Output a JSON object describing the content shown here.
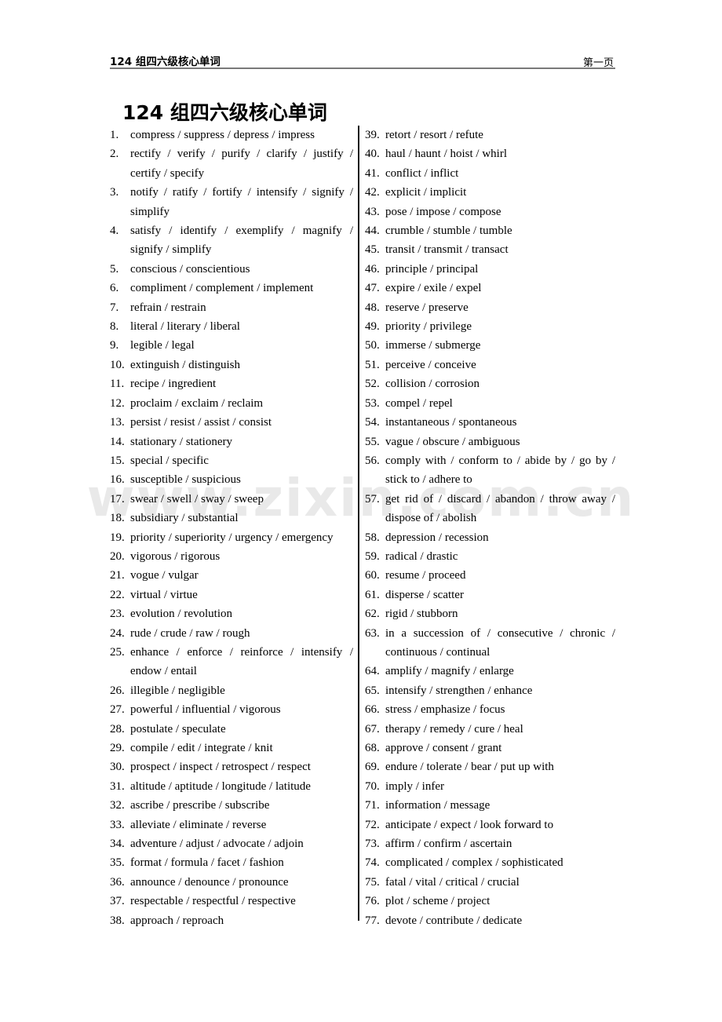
{
  "header": {
    "left_title": "124 组四六级核心单词",
    "page_label": "第一页"
  },
  "document": {
    "title": "124 组四六级核心单词",
    "watermark": "www.zixin.com.cn"
  },
  "columns": {
    "left": [
      {
        "num": "1.",
        "text": "compress / suppress / depress / impress",
        "wrap": false
      },
      {
        "num": "2.",
        "text": "rectify / verify / purify / clarify / justify / certify / specify",
        "wrap": true
      },
      {
        "num": "3.",
        "text": "notify / ratify / fortify / intensify / signify / simplify",
        "wrap": true
      },
      {
        "num": "4.",
        "text": "satisfy / identify / exemplify / magnify / signify / simplify",
        "wrap": true
      },
      {
        "num": "5.",
        "text": "conscious / conscientious",
        "wrap": false
      },
      {
        "num": "6.",
        "text": "compliment / complement / implement",
        "wrap": false
      },
      {
        "num": "7.",
        "text": "refrain / restrain",
        "wrap": false
      },
      {
        "num": "8.",
        "text": "literal / literary / liberal",
        "wrap": false
      },
      {
        "num": "9.",
        "text": "legible / legal",
        "wrap": false
      },
      {
        "num": "10.",
        "text": "extinguish / distinguish",
        "wrap": false
      },
      {
        "num": "11.",
        "text": "recipe / ingredient",
        "wrap": false
      },
      {
        "num": "12.",
        "text": "proclaim / exclaim / reclaim",
        "wrap": false
      },
      {
        "num": "13.",
        "text": "persist / resist / assist / consist",
        "wrap": false
      },
      {
        "num": "14.",
        "text": "stationary / stationery",
        "wrap": false
      },
      {
        "num": "15.",
        "text": "special / specific",
        "wrap": false
      },
      {
        "num": "16.",
        "text": "susceptible / suspicious",
        "wrap": false
      },
      {
        "num": "17.",
        "text": "swear / swell / sway / sweep",
        "wrap": false
      },
      {
        "num": "18.",
        "text": "subsidiary / substantial",
        "wrap": false
      },
      {
        "num": "19.",
        "text": "priority / superiority / urgency / emergency",
        "wrap": false
      },
      {
        "num": "20.",
        "text": "vigorous / rigorous",
        "wrap": false
      },
      {
        "num": "21.",
        "text": "vogue / vulgar",
        "wrap": false
      },
      {
        "num": "22.",
        "text": "virtual / virtue",
        "wrap": false
      },
      {
        "num": "23.",
        "text": "evolution / revolution",
        "wrap": false
      },
      {
        "num": "24.",
        "text": "rude / crude / raw / rough",
        "wrap": false
      },
      {
        "num": "25.",
        "text": "enhance / enforce / reinforce / intensify / endow / entail",
        "wrap": true
      },
      {
        "num": "26.",
        "text": "illegible / negligible",
        "wrap": false
      },
      {
        "num": "27.",
        "text": "powerful / influential / vigorous",
        "wrap": false
      },
      {
        "num": "28.",
        "text": "postulate / speculate",
        "wrap": false
      },
      {
        "num": "29.",
        "text": "compile / edit / integrate / knit",
        "wrap": false
      },
      {
        "num": "30.",
        "text": "prospect / inspect / retrospect / respect",
        "wrap": false
      },
      {
        "num": "31.",
        "text": "altitude / aptitude / longitude / latitude",
        "wrap": false
      },
      {
        "num": "32.",
        "text": "ascribe / prescribe / subscribe",
        "wrap": false
      },
      {
        "num": "33.",
        "text": "alleviate / eliminate / reverse",
        "wrap": false
      },
      {
        "num": "34.",
        "text": "adventure / adjust / advocate / adjoin",
        "wrap": false
      },
      {
        "num": "35.",
        "text": "format / formula / facet / fashion",
        "wrap": false
      },
      {
        "num": "36.",
        "text": "announce / denounce / pronounce",
        "wrap": false
      },
      {
        "num": "37.",
        "text": "respectable / respectful / respective",
        "wrap": false
      },
      {
        "num": "38.",
        "text": "approach / reproach",
        "wrap": false
      }
    ],
    "right": [
      {
        "num": "39.",
        "text": "retort / resort / refute",
        "wrap": false
      },
      {
        "num": "40.",
        "text": "haul / haunt / hoist / whirl",
        "wrap": false
      },
      {
        "num": "41.",
        "text": "conflict / inflict",
        "wrap": false
      },
      {
        "num": "42.",
        "text": "explicit / implicit",
        "wrap": false
      },
      {
        "num": "43.",
        "text": "pose / impose / compose",
        "wrap": false
      },
      {
        "num": "44.",
        "text": "crumble / stumble / tumble",
        "wrap": false
      },
      {
        "num": "45.",
        "text": "transit / transmit / transact",
        "wrap": false
      },
      {
        "num": "46.",
        "text": "principle / principal",
        "wrap": false
      },
      {
        "num": "47.",
        "text": "expire / exile / expel",
        "wrap": false
      },
      {
        "num": "48.",
        "text": "reserve / preserve",
        "wrap": false
      },
      {
        "num": "49.",
        "text": "priority / privilege",
        "wrap": false
      },
      {
        "num": "50.",
        "text": "immerse / submerge",
        "wrap": false
      },
      {
        "num": "51.",
        "text": "perceive / conceive",
        "wrap": false
      },
      {
        "num": "52.",
        "text": "collision / corrosion",
        "wrap": false
      },
      {
        "num": "53.",
        "text": "compel / repel",
        "wrap": false
      },
      {
        "num": "54.",
        "text": "instantaneous / spontaneous",
        "wrap": false
      },
      {
        "num": "55.",
        "text": "vague / obscure / ambiguous",
        "wrap": false
      },
      {
        "num": "56.",
        "text": "comply with / conform to / abide by / go by / stick to / adhere to",
        "wrap": true
      },
      {
        "num": "57.",
        "text": "get rid of / discard / abandon / throw away / dispose of / abolish",
        "wrap": true
      },
      {
        "num": "58.",
        "text": "depression / recession",
        "wrap": false
      },
      {
        "num": "59.",
        "text": "radical / drastic",
        "wrap": false
      },
      {
        "num": "60.",
        "text": "resume / proceed",
        "wrap": false
      },
      {
        "num": "61.",
        "text": "disperse / scatter",
        "wrap": false
      },
      {
        "num": "62.",
        "text": "rigid / stubborn",
        "wrap": false
      },
      {
        "num": "63.",
        "text": "in a succession of / consecutive / chronic / continuous / continual",
        "wrap": true
      },
      {
        "num": "64.",
        "text": "amplify / magnify / enlarge",
        "wrap": false
      },
      {
        "num": "65.",
        "text": "intensify / strengthen / enhance",
        "wrap": false
      },
      {
        "num": "66.",
        "text": "stress / emphasize / focus",
        "wrap": false
      },
      {
        "num": "67.",
        "text": "therapy / remedy / cure / heal",
        "wrap": false
      },
      {
        "num": "68.",
        "text": "approve / consent / grant",
        "wrap": false
      },
      {
        "num": "69.",
        "text": "endure / tolerate / bear / put up with",
        "wrap": false
      },
      {
        "num": "70.",
        "text": "imply / infer",
        "wrap": false
      },
      {
        "num": "71.",
        "text": "information / message",
        "wrap": false
      },
      {
        "num": "72.",
        "text": "anticipate / expect / look forward to",
        "wrap": false
      },
      {
        "num": "73.",
        "text": "affirm / confirm / ascertain",
        "wrap": false
      },
      {
        "num": "74.",
        "text": "complicated / complex / sophisticated",
        "wrap": false
      },
      {
        "num": "75.",
        "text": "fatal / vital / critical / crucial",
        "wrap": false
      },
      {
        "num": "76.",
        "text": "plot / scheme / project",
        "wrap": false
      },
      {
        "num": "77.",
        "text": "devote / contribute / dedicate",
        "wrap": false
      }
    ]
  }
}
